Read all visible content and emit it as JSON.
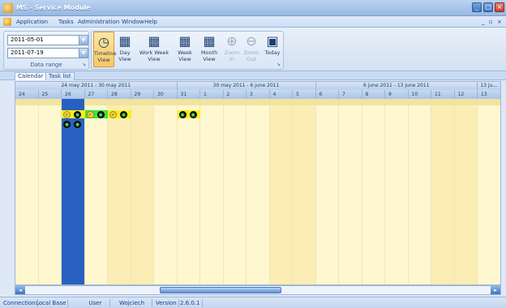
{
  "window": {
    "title": "MS - Service Module",
    "minimize": "_",
    "maximize": "□",
    "close": "×"
  },
  "menu": {
    "items": [
      "Application",
      "Tasks",
      "Administration",
      "Window",
      "Help"
    ],
    "mdi_min": "_",
    "mdi_restore": "▫",
    "mdi_close": "×"
  },
  "ribbon": {
    "date_from": "2011-05-01",
    "date_to": "2011-07-19",
    "date_group_label": "Data range",
    "launcher": "↘",
    "views": [
      {
        "label": "Timeline View",
        "icon": "timeline-icon",
        "glyph": "◷",
        "state": "active"
      },
      {
        "label": "Day View",
        "icon": "day-calendar-icon",
        "glyph": "▦",
        "state": "normal"
      },
      {
        "label": "Work Week View",
        "icon": "work-week-calendar-icon",
        "glyph": "▦",
        "state": "normal"
      },
      {
        "label": "Week View",
        "icon": "week-calendar-icon",
        "glyph": "▦",
        "state": "normal"
      },
      {
        "label": "Month View",
        "icon": "month-calendar-icon",
        "glyph": "▦",
        "state": "normal"
      },
      {
        "label": "Zoom In",
        "icon": "zoom-in-icon",
        "glyph": "⊕",
        "state": "disabled"
      },
      {
        "label": "Zoom Out",
        "icon": "zoom-out-icon",
        "glyph": "⊖",
        "state": "disabled"
      },
      {
        "label": "Today",
        "icon": "today-calendar-icon",
        "glyph": "▣",
        "state": "normal"
      }
    ]
  },
  "tabs": [
    {
      "label": "Calendar",
      "active": true
    },
    {
      "label": "Task list",
      "active": false
    }
  ],
  "calendar": {
    "weeks": [
      "24 may 2011 - 30 may 2011",
      "30 may 2011 - 6 june 2011",
      "6 june 2011 - 13 june 2011",
      "13 ju..."
    ],
    "days": [
      "24",
      "25",
      "26",
      "27",
      "28",
      "29",
      "30",
      "31",
      "1",
      "2",
      "3",
      "4",
      "5",
      "6",
      "7",
      "8",
      "9",
      "10",
      "11",
      "12",
      "13"
    ],
    "selected_day": "26",
    "colors": {
      "selected": "#2a5fc2",
      "green_task": "#3fe23f",
      "yellow_task": "#f7f01e",
      "background": "#fff7cf",
      "weekend": "#fbedb3"
    },
    "task_icons": [
      {
        "icon": "check-done-icon",
        "glyph": "✓"
      },
      {
        "icon": "status-dark-icon",
        "glyph": "●"
      }
    ]
  },
  "status": {
    "connection_label": "Connection",
    "connection_value": "Local Base",
    "user_label": "User",
    "user_value": "Wojciech",
    "version_label": "Version",
    "version_value": "2.6.0.1"
  },
  "scroll": {
    "left": "◂",
    "right": "▸"
  }
}
